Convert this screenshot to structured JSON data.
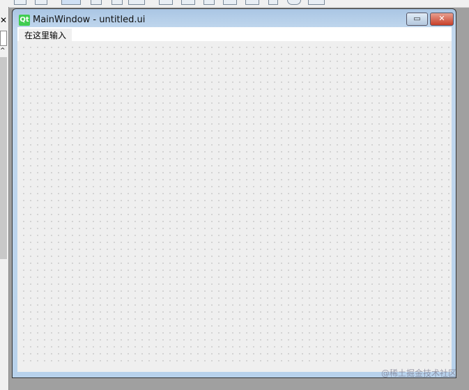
{
  "window": {
    "title": "MainWindow - untitled.ui",
    "app_icon": "Qt",
    "minimize_label": "▭",
    "close_label": "✕"
  },
  "menubar": {
    "placeholder_item": "在这里输入"
  },
  "side_panel": {
    "close_label": "✕",
    "up_label": "^"
  },
  "watermark": "@稀土掘金技术社区"
}
